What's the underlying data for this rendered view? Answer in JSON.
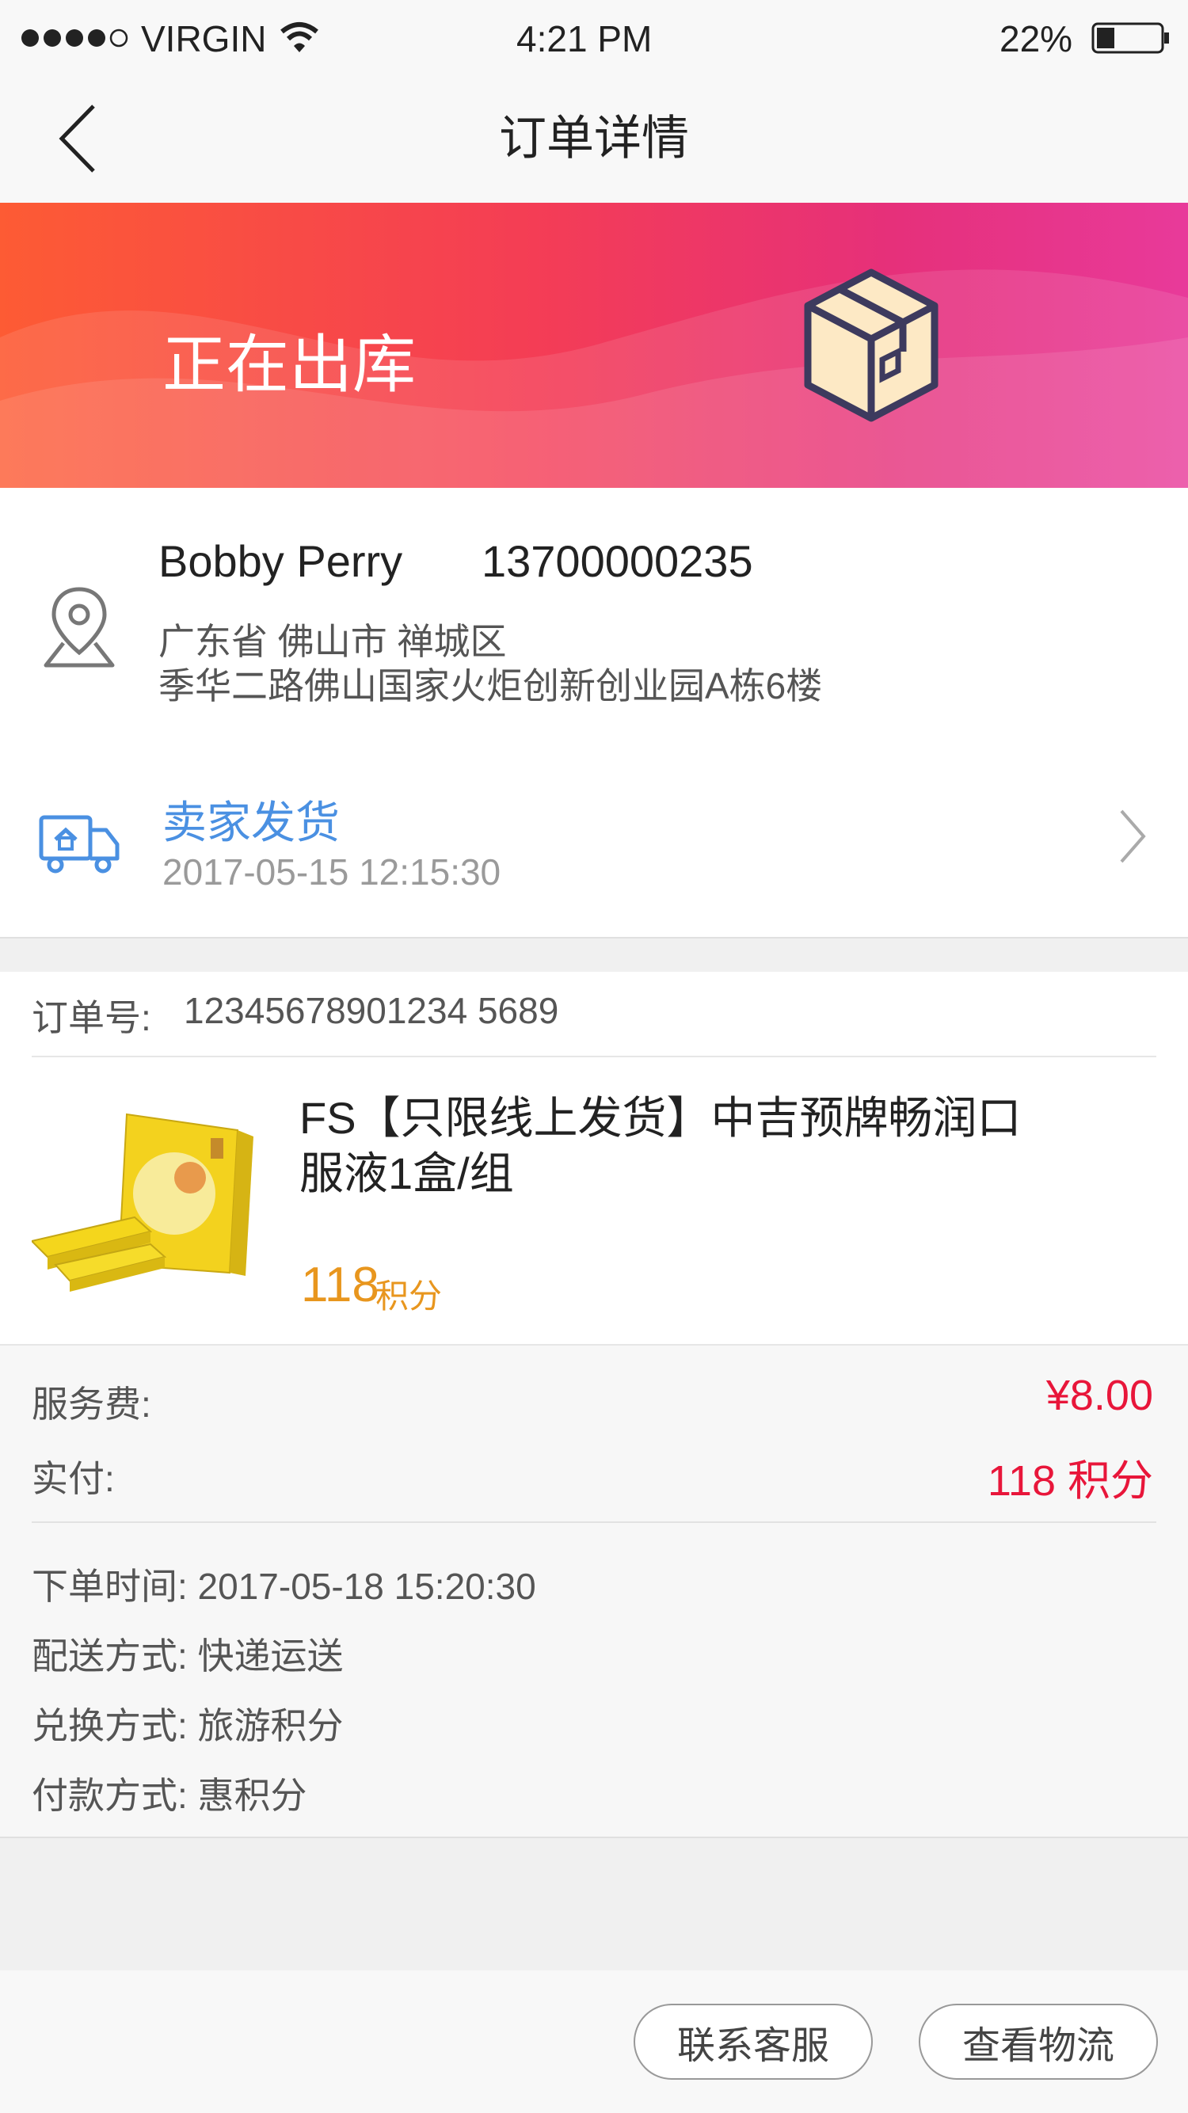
{
  "status_bar": {
    "carrier": "VIRGIN",
    "time": "4:21 PM",
    "battery": "22%"
  },
  "nav": {
    "title": "订单详情"
  },
  "banner": {
    "status": "正在出库"
  },
  "address": {
    "name": "Bobby Perry",
    "phone": "13700000235",
    "line1": "广东省 佛山市 禅城区",
    "line2": "季华二路佛山国家火炬创新创业园A栋6楼"
  },
  "logistics": {
    "status": "卖家发货",
    "time": "2017-05-15 12:15:30"
  },
  "order": {
    "number_label": "订单号:",
    "number": "12345678901234 5689",
    "product_title_1": "FS【只限线上发货】中吉预牌畅润口",
    "product_title_2": "服液1盒/组",
    "price": "118",
    "price_unit": "积分"
  },
  "summary": {
    "service_fee_label": "服务费:",
    "service_fee": "¥8.00",
    "paid_label": "实付:",
    "paid": "118 积分",
    "order_time": "下单时间: 2017-05-18  15:20:30",
    "delivery": "配送方式: 快递运送",
    "exchange": "兑换方式: 旅游积分",
    "payment": "付款方式: 惠积分"
  },
  "actions": {
    "contact": "联系客服",
    "track": "查看物流"
  },
  "colors": {
    "accent_blue": "#4a90e2",
    "price_orange": "#e8961e",
    "fee_red": "#e8163a"
  }
}
